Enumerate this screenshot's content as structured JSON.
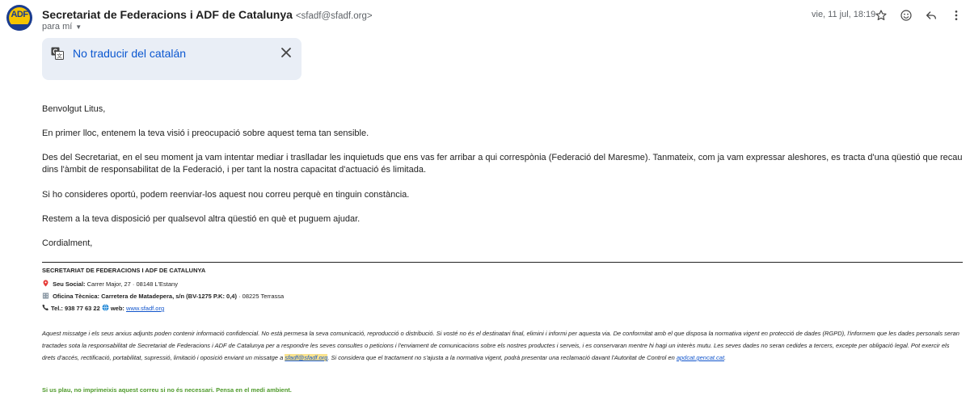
{
  "header": {
    "avatar_text": "ADF",
    "sender_name": "Secretariat de Federacions i ADF de Catalunya",
    "sender_email": "<sfadf@sfadf.org>",
    "recipient": "para mí",
    "date": "vie, 11 jul, 18:19"
  },
  "actions": {
    "star": "star-icon",
    "emoji": "emoji-icon",
    "reply": "reply-icon",
    "more": "more-vert-icon"
  },
  "translate_banner": {
    "link_text": "No traducir del catalán"
  },
  "body": {
    "greeting": "Benvolgut Litus,",
    "p1": "En primer lloc, entenem la teva visió i preocupació sobre aquest tema tan sensible.",
    "p2": "Des del Secretariat, en el seu moment ja vam intentar mediar i traslladar les inquietuds que ens vas fer arribar a qui correspònia (Federació del Maresme). Tanmateix, com ja vam expressar aleshores, es tracta d'una qüestió que recau dins l'àmbit de responsabilitat de la Federació, i per tant la nostra capacitat d'actuació és limitada.",
    "p3": "Si ho consideres oportú, podem reenviar-los aquest nou correu perquè en tinguin constància.",
    "p4": "Restem a la teva disposició per qualsevol altra qüestió en què et puguem ajudar.",
    "closing": "Cordialment,"
  },
  "signature": {
    "org": "SECRETARIAT DE FEDERACIONS  I ADF DE CATALUNYA",
    "seu_label": "Seu Social:",
    "seu_value": "Carrer Major, 27 · 08148 L'Estany",
    "oficina_label": "Oficina Tècnica: Carretera de Matadepera, s/n (BV-1275 P.K: 0,4)",
    "oficina_value": "· 08225 Terrassa",
    "tel_label": "Tel.: 938 77 63 22",
    "web_label": "web:",
    "web_link": "www.sfadf.org"
  },
  "legal": {
    "part1": "Aquest missatge i els seus arxius adjunts poden contenir informació confidencial. No està permesa la seva comunicació, reproducció o distribució. Si vosté no és el destinatari final, elimini i informi per aquesta via. De conformitat amb el que disposa la normativa vigent en protecció de dades (RGPD), l'informem que les dades personals seran tractades sota la responsabilitat de Secretariat de Federacions i ADF de Catalunya per a respondre les seves consultes o peticions i l'enviament de comunicacions sobre els nostres productes i serveis, i es conservaran mentre hi hagi un interès mutu. Les seves dades no seran cedides a tercers, excepte per obligació legal. Pot exercir els drets d'accés, rectificació, portabilitat, supressió, limitació i oposició enviant un missatge a ",
    "email": "sfadf@sfadf.org",
    "part2": ". Si considera que el tractament no s'ajusta a la normativa vigent, podrà presentar una reclamació davant l'Autoritat de Control en ",
    "apd": "apdcat.gencat.cat",
    "part3": "."
  },
  "footer_note": "Si us plau, no imprimeixis aquest correu si no és necessari. Pensa en el medi ambient."
}
